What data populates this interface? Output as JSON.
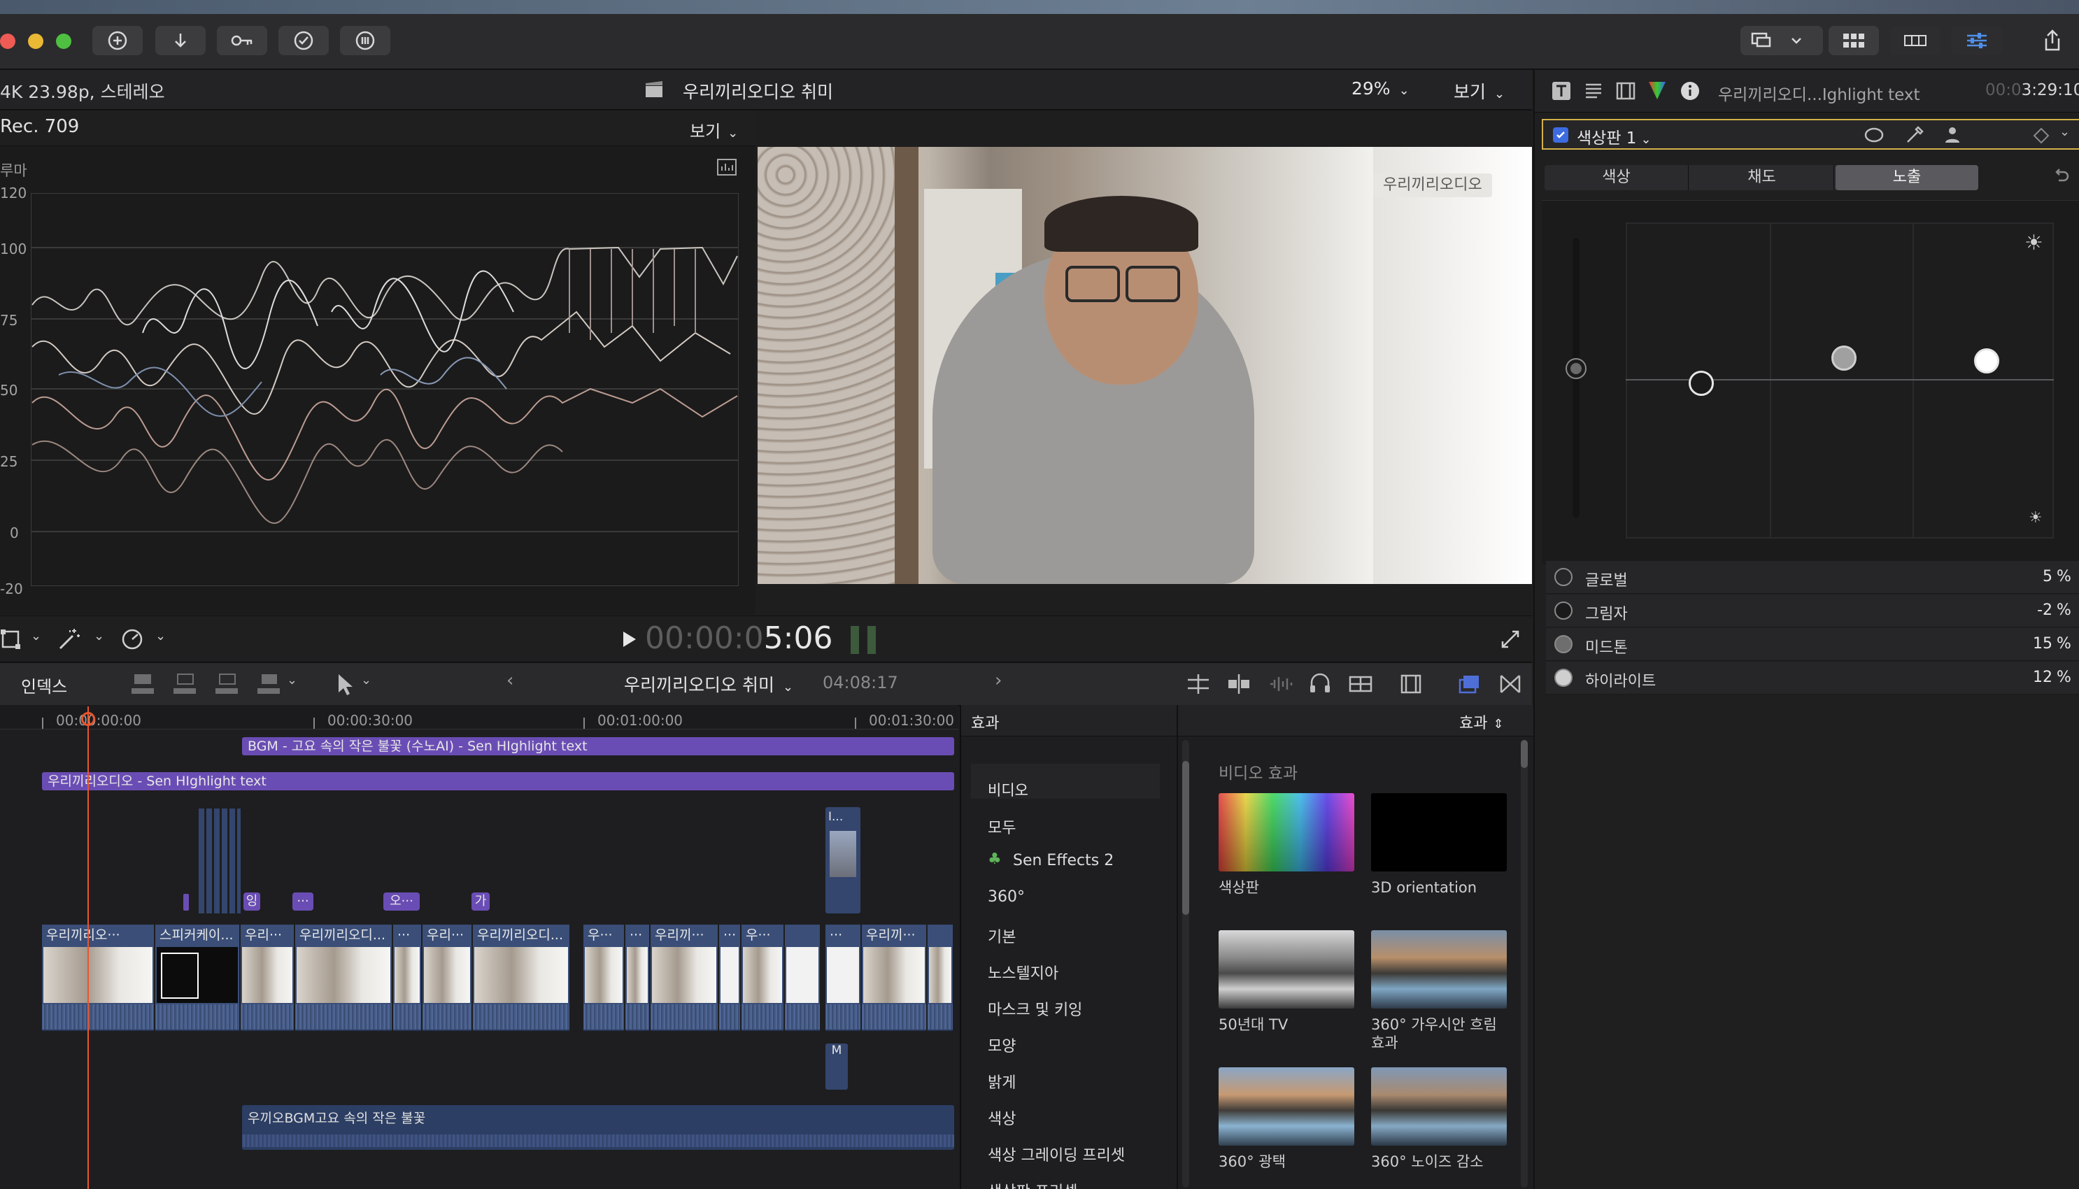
{
  "colors": {
    "accent_purple": "#6a4db4",
    "clip_blue": "#3a4e78",
    "playhead": "#e8562c",
    "checkbox_blue": "#3d6be0",
    "inspector_highlight": "#d4b24a"
  },
  "viewer": {
    "format": "4K 23.98p, 스테레오",
    "project_title": "우리끼리오디오 취미",
    "zoom": "29%",
    "view_menu": "보기",
    "overlay_caption": "우리끼리오디오"
  },
  "scope": {
    "colorspace": "Rec. 709",
    "view_menu": "보기",
    "channel": "루마",
    "levels": [
      "120",
      "100",
      "75",
      "50",
      "25",
      "0",
      "-20"
    ]
  },
  "transport": {
    "timecode_dim": "00:00:0",
    "timecode_bright": "5:06"
  },
  "timeline_bar": {
    "index": "인덱스",
    "project": "우리끼리오디오 취미",
    "duration": "04:08:17"
  },
  "ruler": [
    "00:00:00:00",
    "00:00:30:00",
    "00:01:00:00",
    "00:01:30:00"
  ],
  "tracks": {
    "bgm_top": "BGM - 고요 속의 작은 불꽃 (수노AI) - Sen HIghlight text",
    "title_clip": "우리끼리오디오 - Sen HIghlight text",
    "bgm_bottom": "우끼오BGM고요 속의 작은 불꽃",
    "connected_top": "I...",
    "connected_bottom": "M",
    "markers": [
      "잉",
      "···",
      "오···",
      "가"
    ],
    "clips": [
      "우리끼리오···",
      "스피커케이...",
      "우리···",
      "우리끼리오디...",
      "···",
      "우리···",
      "우리끼리오디...",
      "우···",
      "···",
      "우리끼···",
      "···",
      "우···",
      "",
      "···",
      "우리끼···",
      ""
    ]
  },
  "effects": {
    "header_left": "효과",
    "header_right": "효과",
    "categories": [
      "비디오",
      "모두",
      "Sen Effects 2",
      "360°",
      "기본",
      "노스텔지아",
      "마스크 및 키잉",
      "모양",
      "밝게",
      "색상",
      "색상 그레이딩 프리셋",
      "색상판 프리셋"
    ],
    "section": "비디오 효과",
    "items": [
      "색상판",
      "3D orientation",
      "50년대 TV",
      "360° 가우시안 흐림 효과",
      "360° 광택",
      "360° 노이즈 감소"
    ]
  },
  "inspector": {
    "clip_name": "우리끼리오디...Ighlight text",
    "duration_dim": "00:0",
    "duration_bright": "3:29:10",
    "board": "색상판 1",
    "tabs": [
      "색상",
      "채도",
      "노출"
    ],
    "active_tab": "노출",
    "rows": [
      {
        "label": "글로벌",
        "value": "5",
        "unit": "%"
      },
      {
        "label": "그림자",
        "value": "-2",
        "unit": "%"
      },
      {
        "label": "미드톤",
        "value": "15",
        "unit": "%"
      },
      {
        "label": "하이라이트",
        "value": "12",
        "unit": "%"
      }
    ]
  }
}
